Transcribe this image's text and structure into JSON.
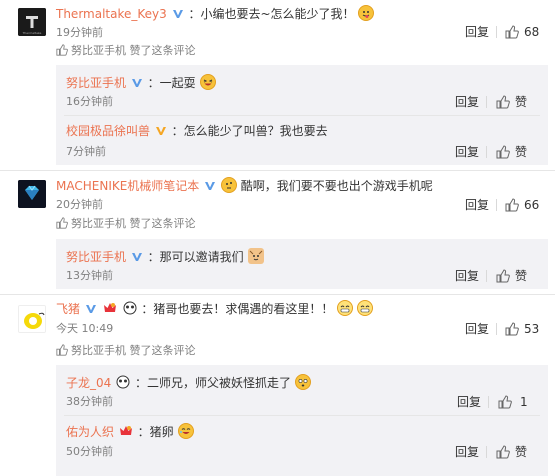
{
  "comments": [
    {
      "username": "Thermaltake_Key3",
      "text": "：小编也要去~怎么能少了我！",
      "time": "19分钟前",
      "reply": "回复",
      "likes": "68",
      "liked_by": "努比亚手机 赞了这条评论",
      "replies": [
        {
          "username": "努比亚手机",
          "text": "：一起耍",
          "time": "16分钟前",
          "reply": "回复",
          "like": "赞"
        },
        {
          "username": "校园极品徐叫兽",
          "text": "：怎么能少了叫兽？我也要去",
          "time": "7分钟前",
          "reply": "回复",
          "like": "赞"
        }
      ]
    },
    {
      "username": "MACHENIKE机械师笔记本",
      "text": "酷啊，我们要不要也出个游戏手机呢",
      "time": "20分钟前",
      "reply": "回复",
      "likes": "66",
      "liked_by": "努比亚手机 赞了这条评论",
      "replies": [
        {
          "username": "努比亚手机",
          "text": "：那可以邀请我们",
          "time": "13分钟前",
          "reply": "回复",
          "like": "赞"
        }
      ]
    },
    {
      "username": "飞猪",
      "text": "：猪哥也要去！求偶遇的看这里！！",
      "time": "今天 10:49",
      "reply": "回复",
      "likes": "53",
      "liked_by": "努比亚手机 赞了这条评论",
      "replies": [
        {
          "username": "子龙_04",
          "text": "：二师兄，师父被妖怪抓走了",
          "time": "38分钟前",
          "reply": "回复",
          "like": "1"
        },
        {
          "username": "佑为人织",
          "text": "：猪卵",
          "time": "50分钟前",
          "reply": "回复",
          "like": "赞"
        }
      ]
    }
  ],
  "colors": {
    "name": "#eb7350",
    "subbg": "#f2f2f5",
    "verified": "#5a9ae6",
    "gold": "#f5a623"
  },
  "icons": {
    "like": "thumbs-up-icon",
    "verified": "verified-v-icon",
    "liked_by": "thumbs-up-icon"
  }
}
